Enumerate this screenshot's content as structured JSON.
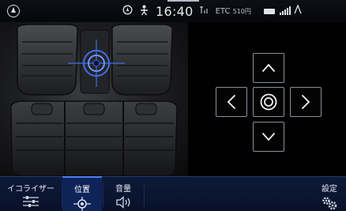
{
  "status_bar": {
    "time": "16:40",
    "etc_label": "ETC",
    "etc_amount": "510円",
    "icons": [
      "home-icon",
      "location-icon",
      "person-icon",
      "antenna-icon",
      "battery-icon",
      "signal-icon"
    ]
  },
  "seat_view": {
    "image_description_icon": "car-seat-diagram",
    "sound_position_marker": "crosshair-icon",
    "accent_color": "#3f6fe8"
  },
  "position_pad": {
    "buttons": [
      "up",
      "left",
      "center",
      "right",
      "down"
    ],
    "icons": [
      "chevron-up-icon",
      "chevron-left-icon",
      "target-icon",
      "chevron-right-icon",
      "chevron-down-icon"
    ]
  },
  "tabs": [
    {
      "label": "イコライザー",
      "icon": "equalizer-icon",
      "active": false
    },
    {
      "label": "位置",
      "icon": "position-icon",
      "active": true
    },
    {
      "label": "音量",
      "icon": "speaker-icon",
      "active": false
    },
    {
      "label": "設定",
      "icon": "settings-gears-icon",
      "active": false
    }
  ],
  "colors": {
    "tab_bar": "#0a1633",
    "tab_active": "#0e2358",
    "tab_active_indicator": "#4f7ef2",
    "pad_border": "#8a8f99"
  }
}
